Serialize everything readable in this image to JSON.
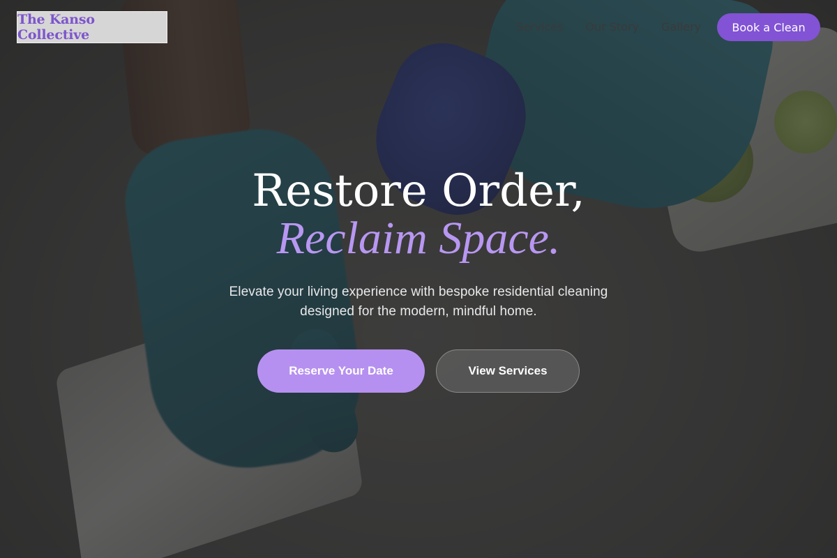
{
  "brand": {
    "name": "The Kanso Collective"
  },
  "nav": {
    "items": [
      {
        "label": "Services"
      },
      {
        "label": "Our Story"
      },
      {
        "label": "Gallery"
      }
    ],
    "cta_label": "Book a Clean"
  },
  "hero": {
    "title_line1": "Restore Order,",
    "title_line2": "Reclaim Space.",
    "subtitle_line1": "Elevate your living experience with bespoke residential cleaning",
    "subtitle_line2": "designed for the modern, mindful home.",
    "primary_cta": "Reserve Your Date",
    "secondary_cta": "View Services"
  },
  "colors": {
    "accent": "#8253d4",
    "accent_light": "#b690f0",
    "headline_italic": "#b897f2",
    "overlay": "#222222"
  }
}
